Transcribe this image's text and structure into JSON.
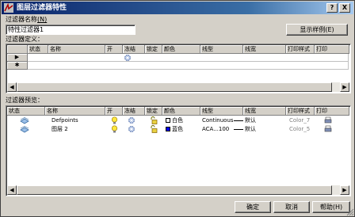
{
  "dialog": {
    "title": "图层过滤器特性",
    "help_glyph": "?",
    "close_glyph": "X"
  },
  "filter_name": {
    "label": "过滤器名称",
    "shortcut": "(N)",
    "value": "特性过滤器1"
  },
  "show_example_button": "显示样例(E)",
  "definition": {
    "label": "过滤器定义：",
    "columns": [
      "状态",
      "名称",
      "开",
      "冻结",
      "锁定",
      "颜色",
      "线型",
      "线宽",
      "打印样式",
      "打印"
    ],
    "row_markers": [
      "▶",
      "✱"
    ]
  },
  "preview": {
    "label": "过滤器预览：",
    "columns": [
      "状态",
      "名称",
      "开",
      "冻结",
      "锁定",
      "颜色",
      "线型",
      "线宽",
      "打印样式",
      "打印"
    ],
    "rows": [
      {
        "name": "Defpoints",
        "color_name": "白色",
        "color_hex": "#ffffff",
        "linetype": "Continuous",
        "lineweight": "默认",
        "plotstyle": "Color_7"
      },
      {
        "name": "图层 2",
        "color_name": "蓝色",
        "color_hex": "#0000ff",
        "linetype": "ACA...100",
        "lineweight": "默认",
        "plotstyle": "Color_5"
      }
    ]
  },
  "buttons": {
    "ok": "确定",
    "cancel": "取消",
    "help": "帮助(H)"
  }
}
